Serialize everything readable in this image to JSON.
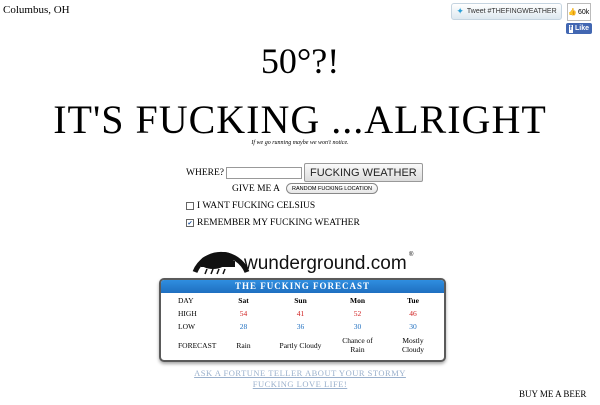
{
  "header": {
    "location": "Columbus, OH",
    "tweet_label": "Tweet #THEFINGWEATHER",
    "like_count": "60k",
    "like_label": "Like"
  },
  "weather": {
    "temp": "50°?!",
    "headline": "IT'S FUCKING ...ALRIGHT",
    "remark": "If we go running maybe we won't notice."
  },
  "form": {
    "where_label": "WHERE?",
    "where_value": "",
    "submit_label": "FUCKING WEATHER",
    "give_label": "GIVE ME A",
    "random_label": "RANDOM FUCKING LOCATION",
    "celsius_label": "I WANT FUCKING CELSIUS",
    "celsius_checked": false,
    "remember_label": "REMEMBER MY FUCKING WEATHER",
    "remember_checked": true
  },
  "wunderground": {
    "logo_text": "wunderground.com",
    "reg_mark": "®"
  },
  "forecast": {
    "title": "THE FUCKING FORECAST",
    "labels": {
      "day": "DAY",
      "high": "HIGH",
      "low": "LOW",
      "forecast": "FORECAST"
    },
    "days": [
      {
        "day": "Sat",
        "high": "54",
        "low": "28",
        "cond": "Rain"
      },
      {
        "day": "Sun",
        "high": "41",
        "low": "36",
        "cond": "Partly Cloudy"
      },
      {
        "day": "Mon",
        "high": "52",
        "low": "30",
        "cond": "Chance of Rain"
      },
      {
        "day": "Tue",
        "high": "46",
        "low": "30",
        "cond": "Mostly Cloudy"
      }
    ],
    "colors": {
      "high": "#d02020",
      "low": "#1f6fc0",
      "title_bg": "#1f6fc0"
    }
  },
  "footer": {
    "fortune_link": "ASK A FORTUNE TELLER ABOUT YOUR STORMY FUCKING LOVE LIFE!",
    "beer_label": "BUY ME A BEER"
  }
}
